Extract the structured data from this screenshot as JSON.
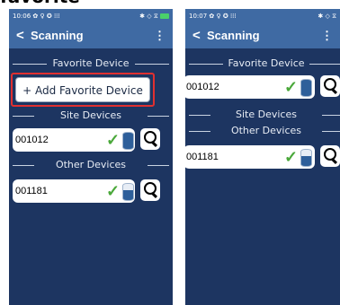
{
  "caption": "favorite",
  "left": {
    "status": {
      "time": "10:06",
      "icons": "✿ ♀ ✪ ⁞⁞⁞"
    },
    "appbar": {
      "back": "<",
      "title": "Scanning",
      "menu": "⋮"
    },
    "sections": {
      "favorite": "Favorite Device",
      "site": "Site Devices",
      "other": "Other Devices"
    },
    "add_button": "+ Add Favorite Device",
    "site_devices": [
      {
        "id": "001012"
      }
    ],
    "other_devices": [
      {
        "id": "001181"
      }
    ]
  },
  "right": {
    "status": {
      "time": "10:07",
      "icons": "✿ ♀ ✪ ⁞⁞⁞"
    },
    "appbar": {
      "back": "<",
      "title": "Scanning",
      "menu": "⋮"
    },
    "sections": {
      "favorite": "Favorite Device",
      "site": "Site Devices",
      "other": "Other Devices"
    },
    "favorite_devices": [
      {
        "id": "001012"
      }
    ],
    "other_devices": [
      {
        "id": "001181"
      }
    ]
  },
  "colors": {
    "accent": "#3f6aa3",
    "background": "#1d3561",
    "highlight": "#e03030",
    "check": "#4aa83a"
  }
}
